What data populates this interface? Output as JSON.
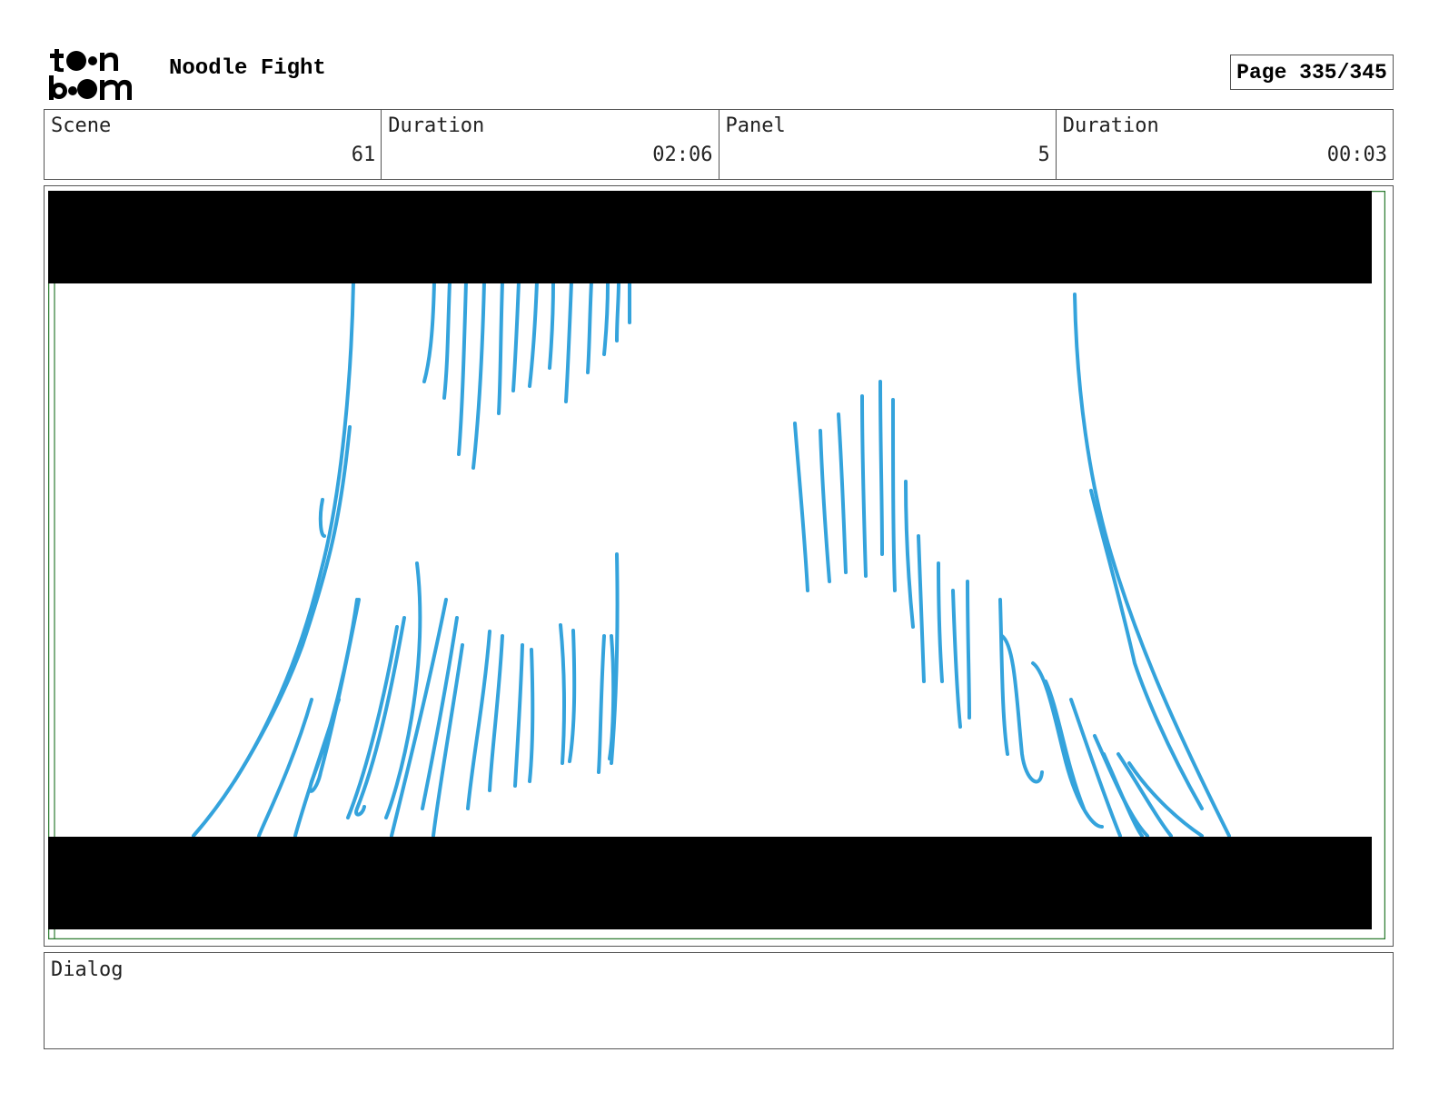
{
  "header": {
    "logo_text": "toon boom",
    "project_title": "Noodle Fight",
    "page_label": "Page 335/345"
  },
  "info": {
    "scene_label": "Scene",
    "scene_value": "61",
    "scene_duration_label": "Duration",
    "scene_duration_value": "02:06",
    "panel_label": "Panel",
    "panel_value": "5",
    "panel_duration_label": "Duration",
    "panel_duration_value": "00:03"
  },
  "panel_image": {
    "description_icon": "storyboard-sketch",
    "stroke_color": "#34a3dc",
    "letterbox_color": "#000000",
    "frame_color": "#2e7d32"
  },
  "dialog": {
    "label": "Dialog",
    "text": ""
  }
}
